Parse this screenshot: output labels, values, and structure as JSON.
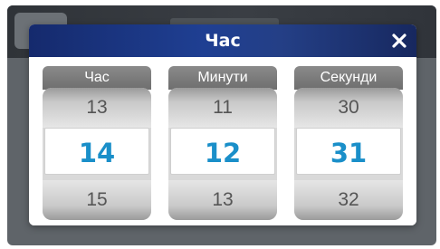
{
  "dialog": {
    "title": "Час"
  },
  "picker": {
    "hours": {
      "header": "Час",
      "prev": "13",
      "current": "14",
      "next": "15"
    },
    "minutes": {
      "header": "Минути",
      "prev": "11",
      "current": "12",
      "next": "13"
    },
    "seconds": {
      "header": "Секунди",
      "prev": "30",
      "current": "31",
      "next": "32"
    }
  },
  "colors": {
    "titlebar": "#1f3f92",
    "selected_value": "#1a8fc9",
    "column_header": "#7a7a7a"
  },
  "icons": {
    "close": "close-icon"
  }
}
